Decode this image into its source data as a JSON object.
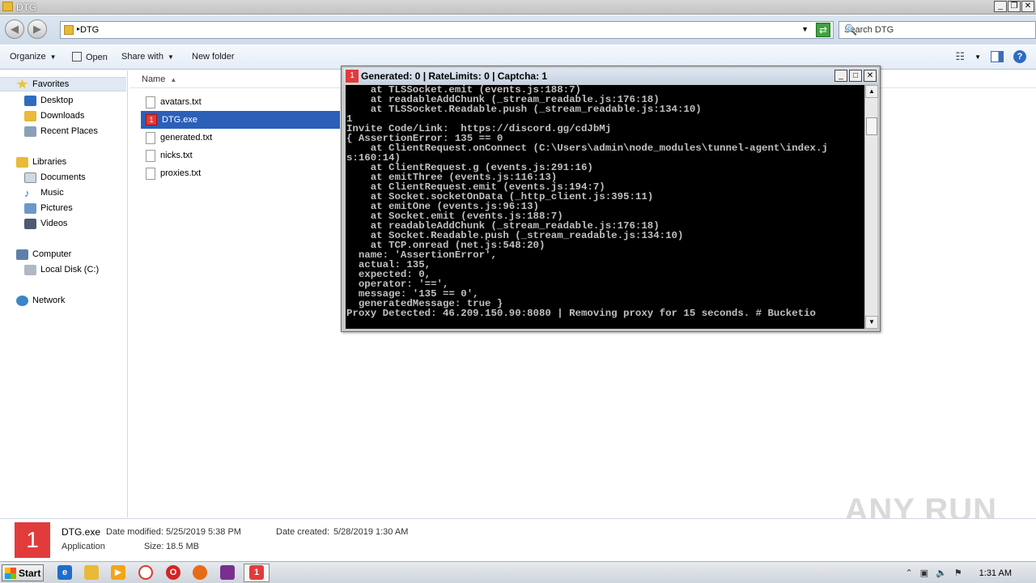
{
  "window": {
    "title": "DTG"
  },
  "address": {
    "crumb": "DTG",
    "search_placeholder": "Search DTG"
  },
  "toolbar": {
    "organize": "Organize",
    "open": "Open",
    "share_with": "Share with",
    "new_folder": "New folder"
  },
  "nav": {
    "favorites": "Favorites",
    "desktop": "Desktop",
    "downloads": "Downloads",
    "recent_places": "Recent Places",
    "libraries": "Libraries",
    "documents": "Documents",
    "music": "Music",
    "pictures": "Pictures",
    "videos": "Videos",
    "computer": "Computer",
    "local_disk": "Local Disk (C:)",
    "network": "Network"
  },
  "columns": {
    "name": "Name"
  },
  "files": [
    {
      "name": "avatars.txt",
      "icon": "text-file-icon"
    },
    {
      "name": "DTG.exe",
      "icon": "exe-icon"
    },
    {
      "name": "generated.txt",
      "icon": "text-file-icon"
    },
    {
      "name": "nicks.txt",
      "icon": "text-file-icon"
    },
    {
      "name": "proxies.txt",
      "icon": "text-file-icon"
    }
  ],
  "console": {
    "title": "Generated: 0 | RateLimits: 0 | Captcha: 1",
    "output": "    at TLSSocket.emit (events.js:188:7)\n    at readableAddChunk (_stream_readable.js:176:18)\n    at TLSSocket.Readable.push (_stream_readable.js:134:10)\n1\nInvite Code/Link:  https://discord.gg/cdJbMj\n{ AssertionError: 135 == 0\n    at ClientRequest.onConnect (C:\\Users\\admin\\node_modules\\tunnel-agent\\index.j\ns:160:14)\n    at ClientRequest.g (events.js:291:16)\n    at emitThree (events.js:116:13)\n    at ClientRequest.emit (events.js:194:7)\n    at Socket.socketOnData (_http_client.js:395:11)\n    at emitOne (events.js:96:13)\n    at Socket.emit (events.js:188:7)\n    at readableAddChunk (_stream_readable.js:176:18)\n    at Socket.Readable.push (_stream_readable.js:134:10)\n    at TCP.onread (net.js:548:20)\n  name: 'AssertionError',\n  actual: 135,\n  expected: 0,\n  operator: '==',\n  message: '135 == 0',\n  generatedMessage: true }\nProxy Detected: 46.209.150.90:8080 | Removing proxy for 15 seconds. # Bucketio"
  },
  "details": {
    "filename": "DTG.exe",
    "type": "Application",
    "modified_label": "Date modified:",
    "modified_value": "5/25/2019 5:38 PM",
    "size_label": "Size:",
    "size_value": "18.5 MB",
    "created_label": "Date created:",
    "created_value": "5/28/2019 1:30 AM",
    "icon_glyph": "1"
  },
  "watermark": "ANY RUN",
  "taskbar": {
    "start": "Start",
    "clock": "1:31 AM"
  },
  "colors": {
    "accent": "#2b5fb8",
    "app_red": "#e23b3b",
    "console_bg": "#000000",
    "console_fg": "#c0c0c0"
  }
}
